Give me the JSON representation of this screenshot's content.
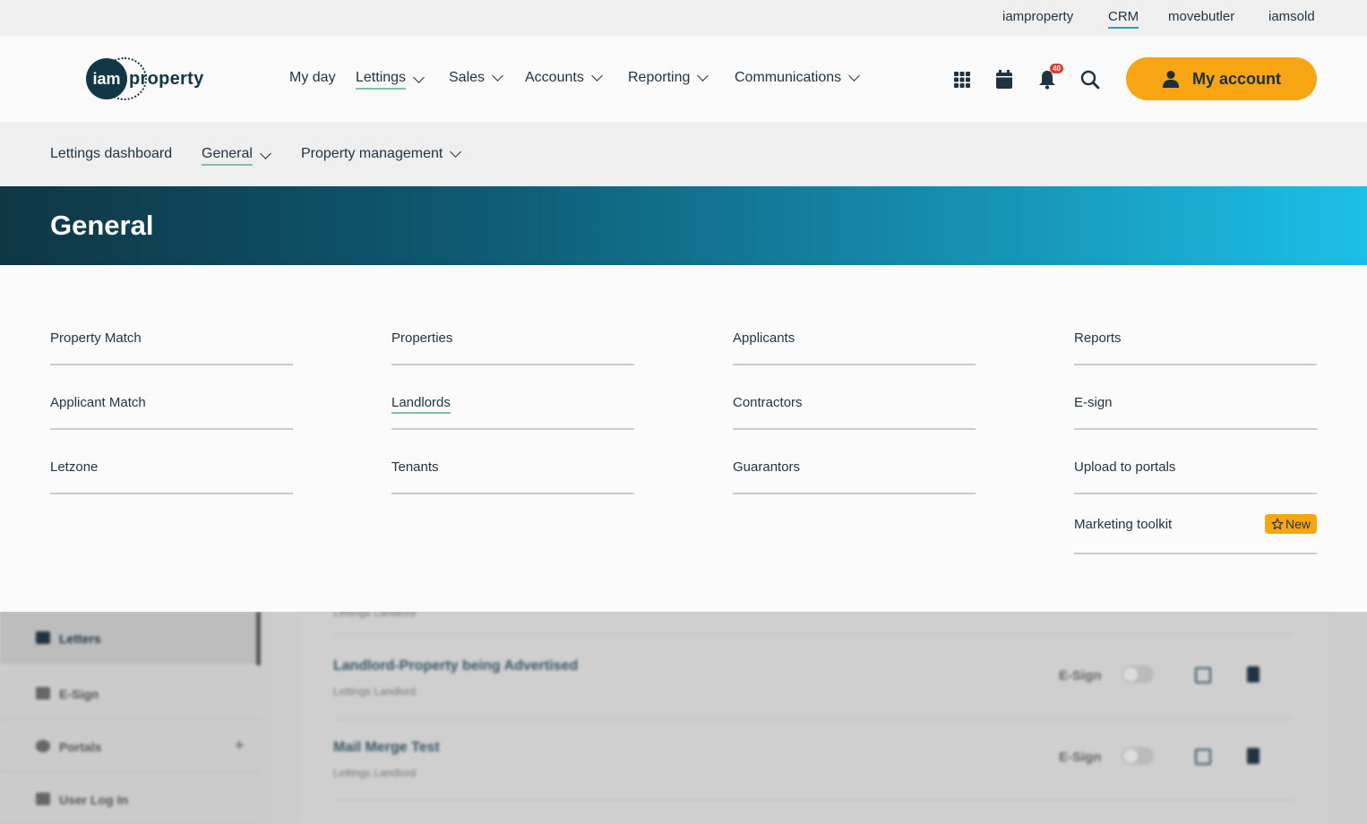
{
  "topbar": {
    "links": [
      "iamproperty",
      "CRM",
      "movebutler",
      "iamsold"
    ],
    "active": "CRM"
  },
  "logo": {
    "mark": "iam",
    "word": "property"
  },
  "mainnav": {
    "items": [
      "My day",
      "Lettings",
      "Sales",
      "Accounts",
      "Reporting",
      "Communications"
    ],
    "active": "Lettings",
    "notification_count": "40",
    "account_label": "My account"
  },
  "subnav": {
    "items": [
      "Lettings dashboard",
      "General",
      "Property management"
    ],
    "active": "General"
  },
  "banner": {
    "title": "General"
  },
  "menu": {
    "columns": [
      [
        "Property Match",
        "Applicant Match",
        "Letzone"
      ],
      [
        "Properties",
        "Landlords",
        "Tenants"
      ],
      [
        "Applicants",
        "Contractors",
        "Guarantors"
      ],
      [
        "Reports",
        "E-sign",
        "Upload to portals",
        "Marketing toolkit"
      ]
    ],
    "active": "Landlords",
    "new_badge": "New"
  },
  "background": {
    "sidebar": [
      "Letters",
      "E-Sign",
      "Portals",
      "User Log In"
    ],
    "rows": [
      {
        "title": "Landlord-Property being Advertised",
        "subtitle": "Lettings Landlord",
        "esign": "E-Sign"
      },
      {
        "title": "Mail Merge Test",
        "subtitle": "Lettings Landlord",
        "esign": "E-Sign"
      }
    ],
    "partial_subtitle": "Lettings Landlord"
  },
  "colors": {
    "accent": "#f7a512",
    "dark": "#123847",
    "banner_end": "#1cbfe6"
  }
}
